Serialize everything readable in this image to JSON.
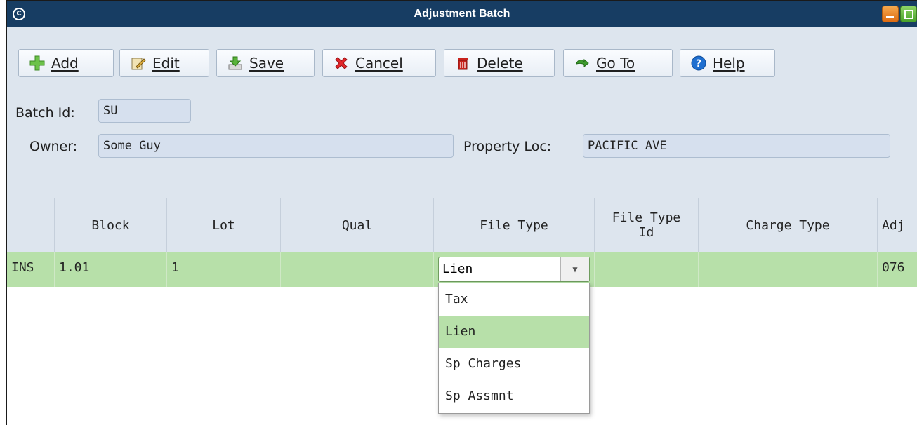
{
  "window": {
    "title": "Adjustment Batch",
    "app_icon": "C"
  },
  "toolbar": {
    "add": "Add",
    "edit": "Edit",
    "save": "Save",
    "cancel": "Cancel",
    "delete": "Delete",
    "goto": "Go To",
    "help": "Help"
  },
  "form": {
    "batch_id_label": "Batch Id:",
    "batch_id_value": "SU",
    "owner_label": "Owner:",
    "owner_value": "Some Guy",
    "property_loc_label": "Property Loc:",
    "property_loc_value": "PACIFIC AVE"
  },
  "grid": {
    "columns": [
      "",
      "Block",
      "Lot",
      "Qual",
      "File Type",
      "File Type Id",
      "Charge Type",
      "Adj"
    ],
    "row": {
      "status": "INS",
      "block": "1.01",
      "lot": "1",
      "qual": "",
      "file_type": "Lien",
      "file_type_id": "",
      "charge_type": "",
      "adj": "076"
    }
  },
  "dropdown": {
    "options": [
      "Tax",
      "Lien",
      "Sp Charges",
      "Sp Assmnt"
    ],
    "selected": "Lien"
  },
  "colors": {
    "titlebar": "#173d63",
    "panel": "#dde5ee",
    "selected_row": "#b7e0a9"
  }
}
